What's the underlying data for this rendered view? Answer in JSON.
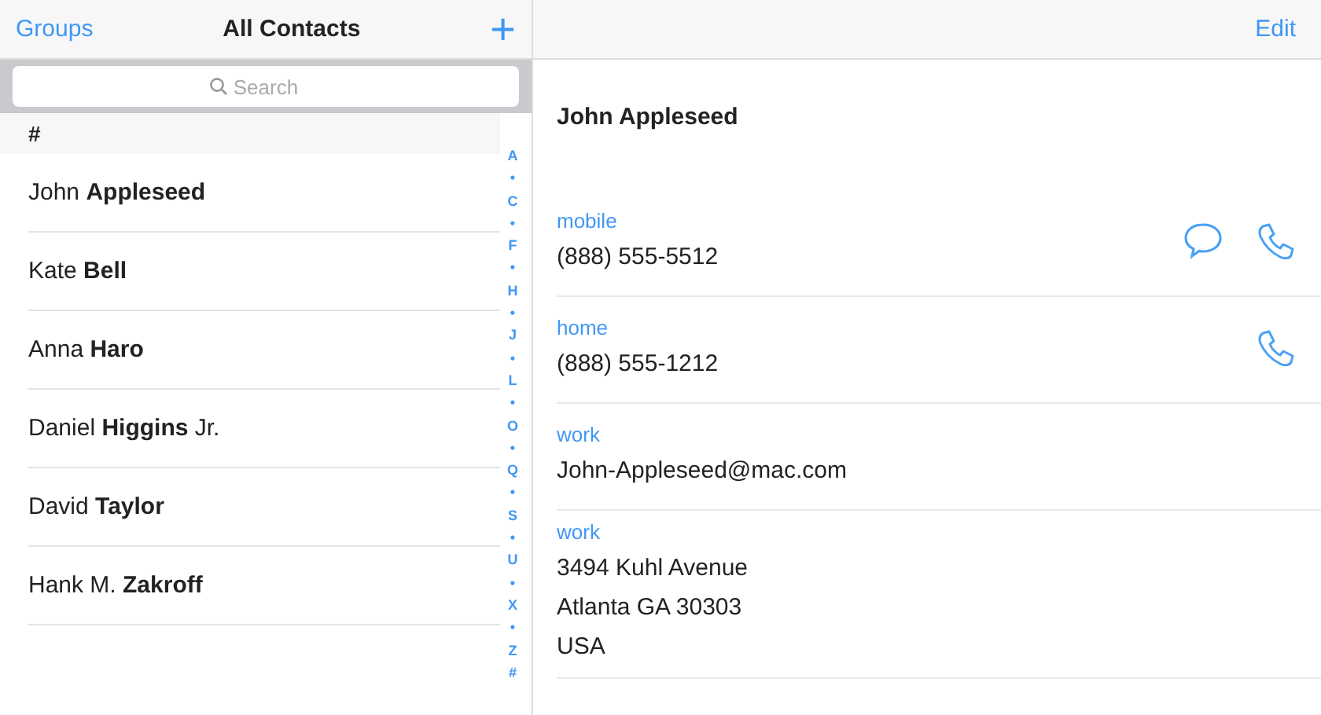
{
  "master": {
    "left_button": "Groups",
    "title": "All Contacts",
    "add_button": "+",
    "search": {
      "placeholder": "Search"
    },
    "section": "#",
    "contacts": [
      {
        "name": "John **Appleseed**"
      },
      {
        "name": "Kate **Bell**"
      },
      {
        "name": "Anna **Haro**"
      },
      {
        "name": "Daniel **Higgins** Jr."
      },
      {
        "name": "David **Taylor**"
      },
      {
        "name": "Hank M. **Zakroff**"
      }
    ],
    "index": [
      "A",
      "•",
      "C",
      "•",
      "F",
      "•",
      "H",
      "•",
      "J",
      "•",
      "L",
      "•",
      "O",
      "•",
      "Q",
      "•",
      "S",
      "•",
      "U",
      "•",
      "X",
      "•",
      "Z",
      "#"
    ]
  },
  "detail": {
    "edit_button": "Edit",
    "name": "John Appleseed",
    "fields": [
      {
        "label": "mobile",
        "lines": [
          "(888) 555-5512"
        ],
        "can_message": true,
        "can_call": true
      },
      {
        "label": "home",
        "lines": [
          "(888) 555-1212"
        ],
        "can_message": false,
        "can_call": true
      },
      {
        "label": "work",
        "lines": [
          "John-Appleseed@mac.com"
        ]
      },
      {
        "label": "work",
        "lines": [
          "3494 Kuhl Avenue",
          "Atlanta GA 30303",
          "USA"
        ]
      }
    ]
  }
}
